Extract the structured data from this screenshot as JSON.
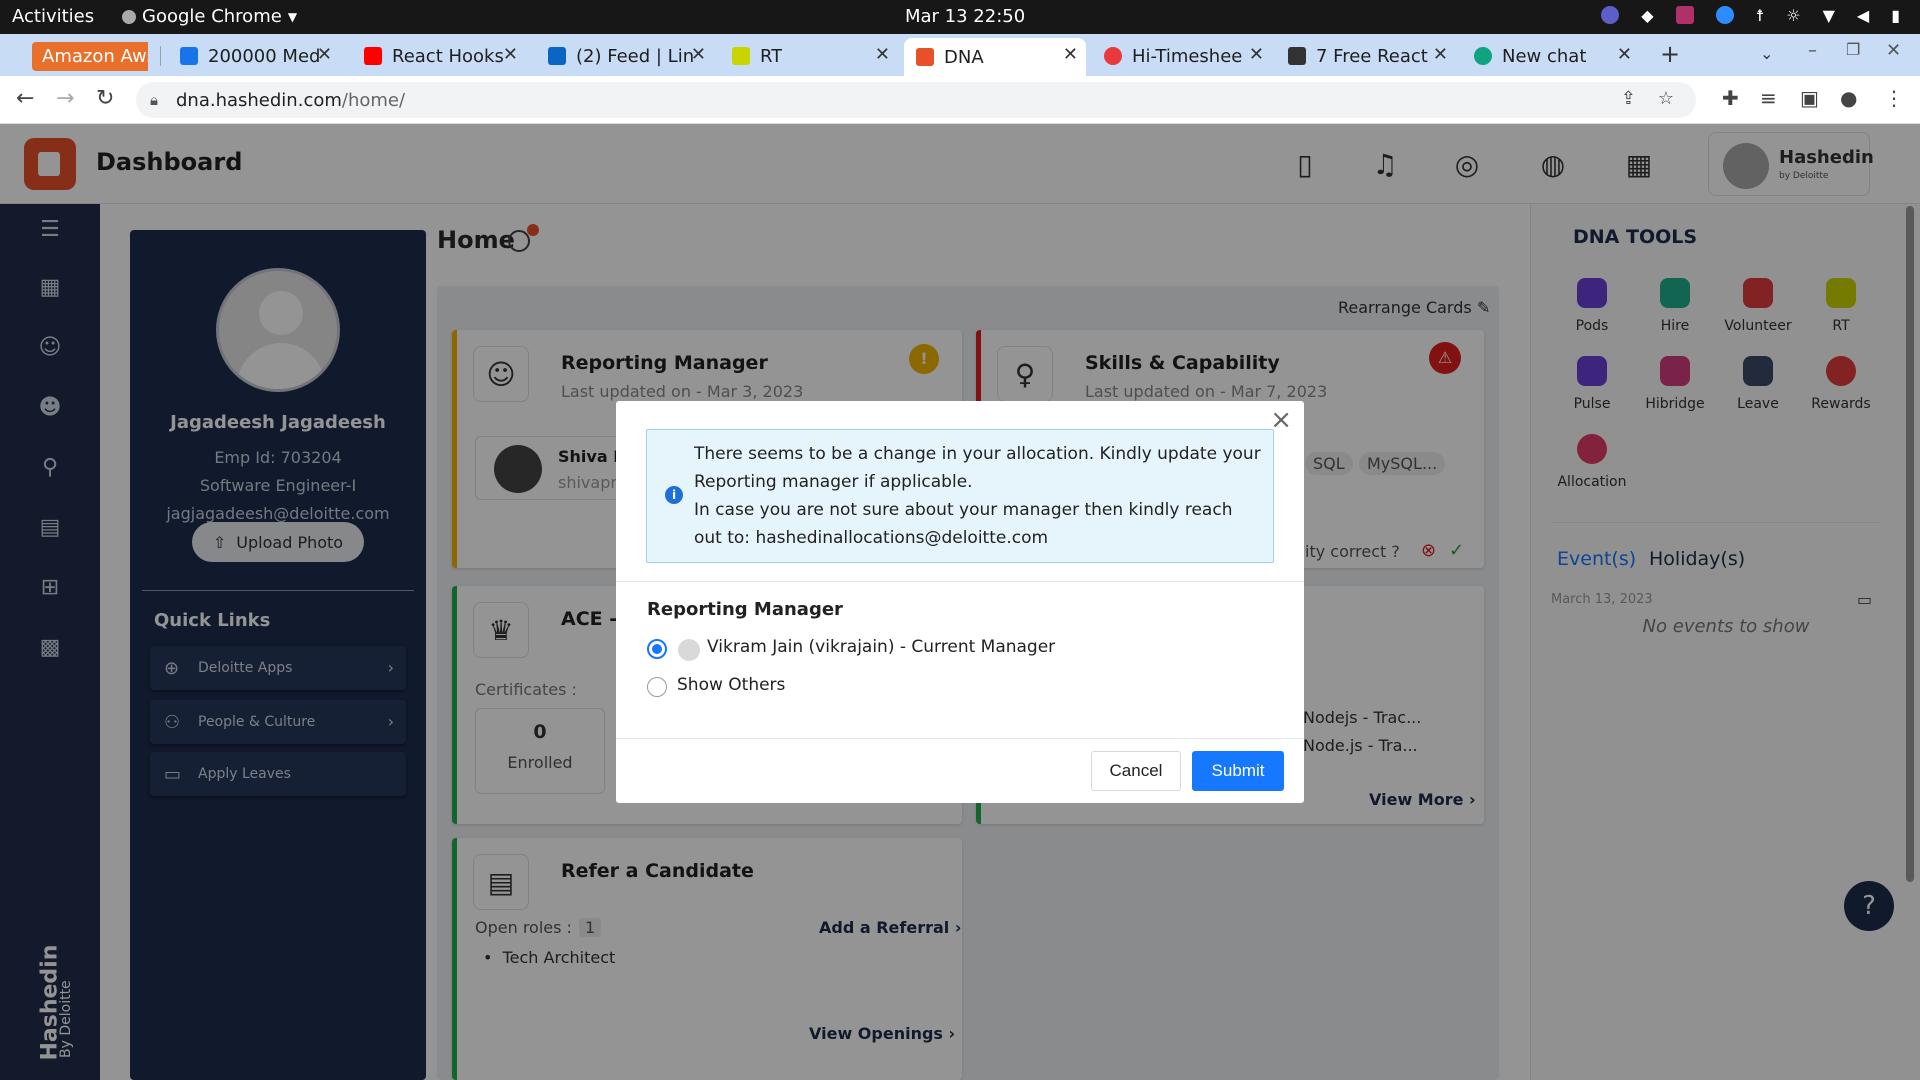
{
  "os_bar": {
    "activities": "Activities",
    "app_name": "Google Chrome",
    "clock": "Mar 13  22:50"
  },
  "tabs": [
    {
      "label": "Amazon Aws",
      "color": "#e8702a"
    },
    {
      "label": "200000 Med",
      "color": "#1a73e8"
    },
    {
      "label": "React Hooks",
      "color": "#ff0000"
    },
    {
      "label": "(2) Feed | Lin",
      "color": "#0a66c2"
    },
    {
      "label": "RT",
      "color": "#c9d400"
    },
    {
      "label": "DNA",
      "color": "#e8502a"
    },
    {
      "label": "Hi-Timeshee",
      "color": "#e83a3a"
    },
    {
      "label": "7 Free React",
      "color": "#333333"
    },
    {
      "label": "New chat",
      "color": "#10a37f"
    }
  ],
  "address_bar": {
    "url_host": "dna.hashedin.com",
    "url_path": "/home/"
  },
  "app": {
    "title": "Dashboard",
    "brand": "Hashedin",
    "brand_sub": "by Deloitte",
    "rail_brand": "Hashedin",
    "rail_brand_sub": "By Deloitte"
  },
  "profile": {
    "name": "Jagadeesh Jagadeesh",
    "emp_id": "Emp Id: 703204",
    "role": "Software Engineer-I",
    "email": "jagjagadeesh@deloitte.com",
    "upload_label": "Upload Photo",
    "quick_links_title": "Quick Links",
    "quick_links": [
      {
        "label": "Deloitte Apps"
      },
      {
        "label": "People & Culture"
      },
      {
        "label": "Apply Leaves"
      }
    ]
  },
  "main": {
    "home_title": "Home",
    "rearrange": "Rearrange Cards",
    "reporting_card": {
      "title": "Reporting Manager",
      "sub": "Last updated on - Mar 3, 2023",
      "manager_name": "Shiva Pr",
      "manager_handle": "shivapra"
    },
    "skills_card": {
      "title": "Skills & Capability",
      "sub": "Last updated on - Mar 7, 2023",
      "chip1": "SQL",
      "chip2": "MySQL...",
      "correct_q": "ity correct ?",
      "course1": "Nodejs - Trac...",
      "course2": "Node.js - Tra...",
      "view_more": "View More"
    },
    "ace_card": {
      "title": "ACE - C",
      "certs_label": "Certificates :",
      "enrolled_count": "0",
      "enrolled_label": "Enrolled",
      "view_more": "View More"
    },
    "refer_card": {
      "title": "Refer a Candidate",
      "open_roles_label": "Open roles :",
      "open_roles_count": "1",
      "add_referral": "Add a Referral",
      "role1": "Tech Architect",
      "view_openings": "View Openings"
    }
  },
  "tools": {
    "title": "DNA TOOLS",
    "items": [
      {
        "label": "Pods",
        "color": "#6a3fd6"
      },
      {
        "label": "Hire",
        "color": "#1fae8c"
      },
      {
        "label": "Volunteer",
        "color": "#e23b3b"
      },
      {
        "label": "RT",
        "color": "#c9d400"
      },
      {
        "label": "Pulse",
        "color": "#6a3fd6"
      },
      {
        "label": "Hibridge",
        "color": "#d33b7a"
      },
      {
        "label": "Leave",
        "color": "#3c4a66"
      },
      {
        "label": "Rewards",
        "color": "#e23b3b"
      },
      {
        "label": "Allocation",
        "color": "#e23b6a"
      }
    ],
    "events_tab": "Event(s)",
    "holidays_tab": "Holiday(s)",
    "date": "March 13, 2023",
    "no_events": "No events to show"
  },
  "modal": {
    "alert_line1": "There seems to be a change in your allocation. Kindly update your Reporting manager if applicable.",
    "alert_line2": "In case you are not sure about your manager then kindly reach out to: hashedinallocations@deloitte.com",
    "section_title": "Reporting Manager",
    "option_current": "Vikram Jain (vikrajain) - Current Manager",
    "option_others": "Show Others",
    "cancel": "Cancel",
    "submit": "Submit"
  },
  "colors": {
    "accent": "#1677ff",
    "navy": "#1e2c4d",
    "brand_orange": "#e8502a"
  }
}
